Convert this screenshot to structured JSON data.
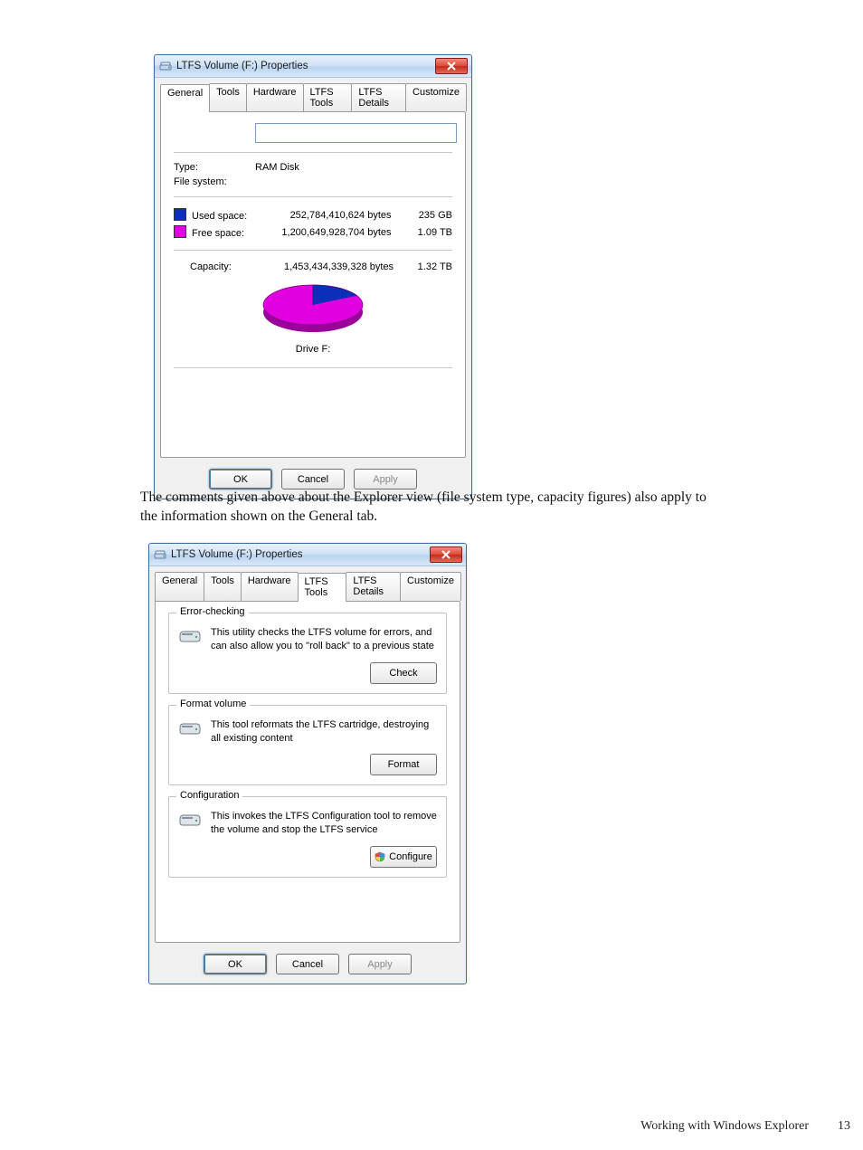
{
  "paragraph_text": "The comments given above about the Explorer view (file system type, capacity figures) also apply to the information shown on the General tab.",
  "footer_text": "Working with Windows Explorer",
  "footer_page": "13",
  "common": {
    "tabs": {
      "general": "General",
      "tools": "Tools",
      "hardware": "Hardware",
      "ltfs_tools": "LTFS Tools",
      "ltfs_details": "LTFS Details",
      "customize": "Customize"
    },
    "ok": "OK",
    "cancel": "Cancel",
    "apply": "Apply",
    "title": "LTFS Volume (F:) Properties"
  },
  "dialog1": {
    "name_value": "",
    "type_label": "Type:",
    "type_value": "RAM Disk",
    "fs_label": "File system:",
    "fs_value": "",
    "used_label": "Used space:",
    "free_label": "Free space:",
    "capacity_label": "Capacity:",
    "used_bytes": "252,784,410,624 bytes",
    "used_h": "235 GB",
    "free_bytes": "1,200,649,928,704 bytes",
    "free_h": "1.09 TB",
    "cap_bytes": "1,453,434,339,328 bytes",
    "cap_h": "1.32 TB",
    "drive_label": "Drive F:"
  },
  "dialog2": {
    "g1_title": "Error-checking",
    "g1_desc": "This utility checks the LTFS volume for errors, and can also allow you to \"roll back\" to a previous state",
    "g1_btn": "Check",
    "g2_title": "Format volume",
    "g2_desc": "This tool reformats the LTFS cartridge, destroying all existing content",
    "g2_btn": "Format",
    "g3_title": "Configuration",
    "g3_desc": "This invokes the LTFS Configuration tool to remove the volume and stop the LTFS service",
    "g3_btn": "Configure"
  },
  "chart_data": {
    "type": "pie",
    "title": "Drive F: usage",
    "categories": [
      "Used space",
      "Free space"
    ],
    "values": [
      252784410624,
      1200649928704
    ],
    "series": [
      {
        "name": "Used space",
        "value_bytes": 252784410624,
        "value_human": "235 GB",
        "color": "#0b2fb8"
      },
      {
        "name": "Free space",
        "value_bytes": 1200649928704,
        "value_human": "1.09 TB",
        "color": "#e000e0"
      }
    ],
    "total_bytes": 1453434339328,
    "total_human": "1.32 TB"
  }
}
